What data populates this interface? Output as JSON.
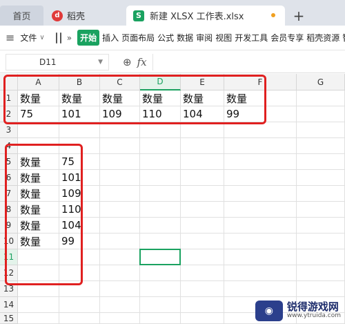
{
  "tabs": {
    "home": "首页",
    "daoke": "稻壳",
    "doc": "新建 XLSX 工作表.xlsx",
    "plus": "+"
  },
  "toolbar": {
    "menu_icon": "≡",
    "file": "文件",
    "more": "»",
    "start": "开始",
    "items": [
      "插入",
      "页面布局",
      "公式",
      "数据",
      "审阅",
      "视图",
      "开发工具",
      "会员专享",
      "稻壳资源",
      "智能"
    ]
  },
  "formula_bar": {
    "name_box": "D11",
    "zoom_icon": "⊕",
    "fx": "fx",
    "content": ""
  },
  "columns": [
    "A",
    "B",
    "C",
    "D",
    "E",
    "F",
    "G"
  ],
  "rows": [
    "1",
    "2",
    "3",
    "4",
    "5",
    "6",
    "7",
    "8",
    "9",
    "10",
    "11",
    "12",
    "13",
    "14",
    "15"
  ],
  "selected_cell": "D11",
  "cells": {
    "r1": [
      "数量",
      "数量",
      "数量",
      "数量",
      "数量",
      "数量"
    ],
    "r2": [
      "75",
      "101",
      "109",
      "110",
      "104",
      "99"
    ],
    "r5": [
      "数量",
      "75"
    ],
    "r6": [
      "数量",
      "101"
    ],
    "r7": [
      "数量",
      "109"
    ],
    "r8": [
      "数量",
      "110"
    ],
    "r9": [
      "数量",
      "104"
    ],
    "r10": [
      "数量",
      "99"
    ]
  },
  "watermark": {
    "title": "锐得游戏网",
    "url": "www.ytruida.com"
  },
  "colors": {
    "accent": "#1aa260",
    "highlight": "#e02020"
  }
}
